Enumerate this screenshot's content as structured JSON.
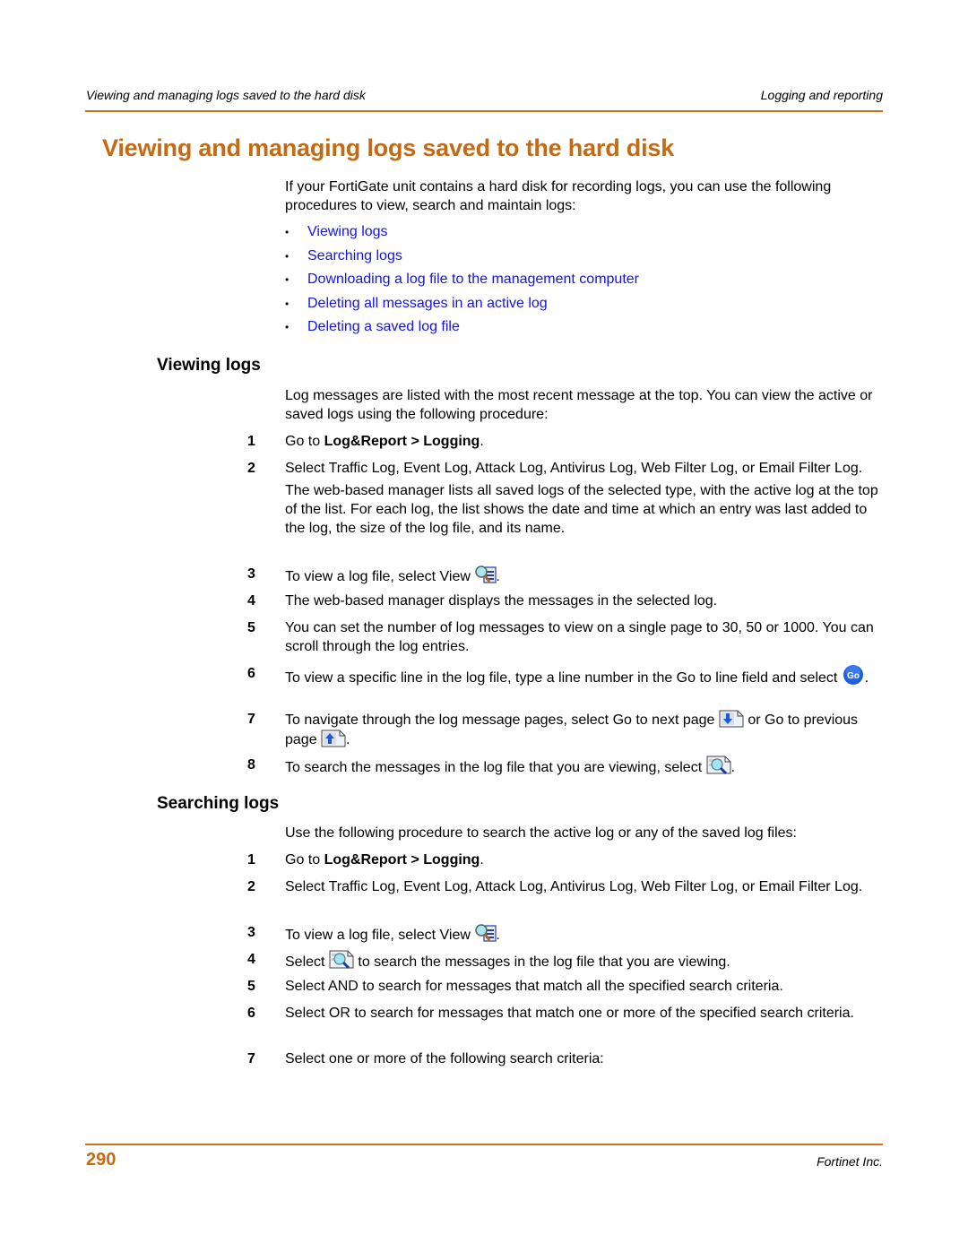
{
  "header": {
    "left": "Viewing and managing logs saved to the hard disk",
    "right": "Logging and reporting"
  },
  "title": "Viewing and managing logs saved to the hard disk",
  "intro": {
    "text": "If your FortiGate unit contains a hard disk for recording logs, you can use the following procedures to view, search and maintain logs:",
    "links": [
      "Viewing logs",
      "Searching logs",
      "Downloading a log file to the management computer",
      "Deleting all messages in an active log",
      "Deleting a saved log file"
    ],
    "link_color": "#1414e6"
  },
  "viewing": {
    "heading": "Viewing logs",
    "intro": "Log messages are listed with the most recent message at the top. You can view the active or saved logs using the following procedure:",
    "steps": [
      {
        "num": "1",
        "pre": "Go to ",
        "bold": "Log&Report > Logging",
        "post": "."
      },
      {
        "num": "2",
        "text": "Select Traffic Log, Event Log, Attack Log, Antivirus Log, Web Filter Log, or Email Filter Log.",
        "extra": "The web-based manager lists all saved logs of the selected type, with the active log at the top of the list. For each log, the list shows the date and time at which an entry was last added to the log, the size of the log file, and its name."
      },
      {
        "num": "3",
        "pre": "To view a log file, select View ",
        "icon": "view-log-icon",
        "post": "."
      },
      {
        "num": "4",
        "text": "The web-based manager displays the messages in the selected log."
      },
      {
        "num": "5",
        "text": "You can set the number of log messages to view on a single page to 30, 50 or 1000. You can scroll through the log entries."
      },
      {
        "num": "6",
        "pre": "To view a specific line in the log file, type a line number in the Go to line field and select ",
        "icon": "go-icon",
        "icon_label": "Go",
        "post": "."
      },
      {
        "num": "7",
        "pre": "To navigate through the log message pages, select Go to next page ",
        "icon": "next-page-icon",
        "mid": " or Go to previous page ",
        "icon2": "previous-page-icon",
        "post": "."
      },
      {
        "num": "8",
        "pre": "To search the messages in the log file that you are viewing, select ",
        "icon": "search-log-icon",
        "post": "."
      }
    ]
  },
  "searching": {
    "heading": "Searching logs",
    "intro": "Use the following procedure to search the active log or any of the saved log files:",
    "steps": [
      {
        "num": "1",
        "pre": "Go to ",
        "bold": "Log&Report > Logging",
        "post": "."
      },
      {
        "num": "2",
        "text": "Select Traffic Log, Event Log, Attack Log, Antivirus Log, Web Filter Log, or Email Filter Log."
      },
      {
        "num": "3",
        "pre": "To view a log file, select View ",
        "icon": "view-log-icon",
        "post": "."
      },
      {
        "num": "4",
        "pre": "Select ",
        "icon": "search-log-icon",
        "post": " to search the messages in the log file that you are viewing."
      },
      {
        "num": "5",
        "text": "Select AND to search for messages that match all the specified search criteria."
      },
      {
        "num": "6",
        "text": "Select OR to search for messages that match one or more of the specified search criteria."
      },
      {
        "num": "7",
        "text": "Select one or more of the following search criteria:"
      }
    ]
  },
  "footer": {
    "page_number": "290",
    "right": "Fortinet Inc."
  },
  "colors": {
    "accent": "#c36a12",
    "rule": "#c8711d",
    "link": "#1414e6"
  }
}
